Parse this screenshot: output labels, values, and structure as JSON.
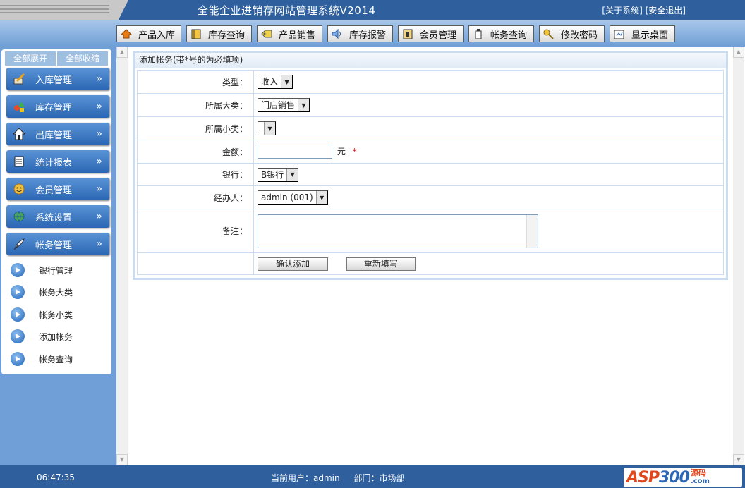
{
  "header": {
    "title": "全能企业进销存网站管理系统V2014",
    "about_link": "[关于系统]",
    "logout_link": "[安全退出]"
  },
  "toolbar": [
    {
      "label": "产品入库",
      "icon": "house-arrow-icon"
    },
    {
      "label": "库存查询",
      "icon": "book-icon"
    },
    {
      "label": "产品销售",
      "icon": "tag-icon"
    },
    {
      "label": "库存报警",
      "icon": "speaker-icon"
    },
    {
      "label": "会员管理",
      "icon": "member-card-icon"
    },
    {
      "label": "帐务查询",
      "icon": "bottle-icon"
    },
    {
      "label": "修改密码",
      "icon": "key-icon"
    },
    {
      "label": "显示桌面",
      "icon": "desktop-icon"
    }
  ],
  "sidebar": {
    "expand_all": "全部展开",
    "collapse_all": "全部收缩",
    "menus": [
      {
        "label": "入库管理",
        "icon": "pencil-icon"
      },
      {
        "label": "库存管理",
        "icon": "shapes-icon"
      },
      {
        "label": "出库管理",
        "icon": "home-icon"
      },
      {
        "label": "统计报表",
        "icon": "report-icon"
      },
      {
        "label": "会员管理",
        "icon": "face-icon"
      },
      {
        "label": "系统设置",
        "icon": "globe-icon"
      },
      {
        "label": "帐务管理",
        "icon": "feather-icon"
      }
    ],
    "chevron": "»",
    "sub_items": [
      {
        "label": "银行管理"
      },
      {
        "label": "帐务大类"
      },
      {
        "label": "帐务小类"
      },
      {
        "label": "添加帐务"
      },
      {
        "label": "帐务查询"
      }
    ]
  },
  "form": {
    "heading": "添加帐务(带*号的为必填项)",
    "type_label": "类型：",
    "type_value": "收入",
    "category_label": "所属大类：",
    "category_value": "门店销售",
    "subcategory_label": "所属小类：",
    "subcategory_value": "",
    "amount_label": "金额：",
    "amount_value": "",
    "amount_unit": "元",
    "required_mark": "*",
    "bank_label": "银行：",
    "bank_value": "B银行",
    "handler_label": "经办人：",
    "handler_value": "admin (001)",
    "note_label": "备注：",
    "note_value": "",
    "submit_label": "确认添加",
    "reset_label": "重新填写"
  },
  "footer": {
    "clock": "06:47:35",
    "user_text": "当前用户：admin",
    "dept_text": "部门：市场部",
    "logo_main": "ASP",
    "logo_num": "300",
    "logo_side_top": "源码",
    "logo_side_bottom": ".com"
  },
  "colors": {
    "header_bg": "#2f5f9c",
    "page_bg": "#6f9fd6",
    "menu_bg": "#2a66b3",
    "required": "#cc0000"
  }
}
